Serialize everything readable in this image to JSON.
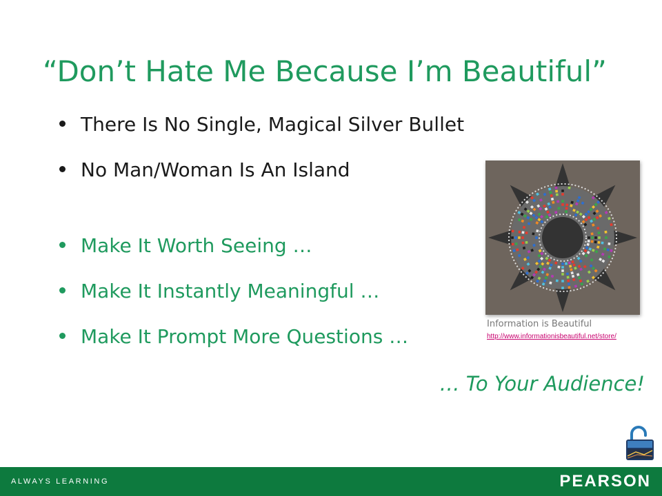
{
  "slide": {
    "title": "“Don’t Hate Me Because I’m Beautiful”",
    "bullets": [
      {
        "text": "There Is No Single, Magical Silver Bullet",
        "color": "#1a1a1a"
      },
      {
        "text": "No Man/Woman Is An Island",
        "color": "#1a1a1a"
      },
      {
        "text": "Make It Worth Seeing …",
        "color": "#1f9a5e"
      },
      {
        "text": "Make It Instantly Meaningful …",
        "color": "#1f9a5e"
      },
      {
        "text": "Make It Prompt More Questions …",
        "color": "#1f9a5e"
      }
    ],
    "closing": "… To Your Audience!"
  },
  "image": {
    "caption": "Information is Beautiful",
    "link": "http://www.informationisbeautiful.net/store/"
  },
  "footer": {
    "tagline": "ALWAYS LEARNING",
    "brand": "PEARSON"
  },
  "colors": {
    "accent": "#1f9a5e",
    "text": "#1a1a1a",
    "footer_bg": "#0d7a3e",
    "footer_text": "#ffffff",
    "caption": "#777777",
    "link": "#c8006e",
    "art_bg": "#6e655d",
    "petal": "#333333"
  },
  "icons": {
    "lock": "unlocked-padlock-icon"
  }
}
